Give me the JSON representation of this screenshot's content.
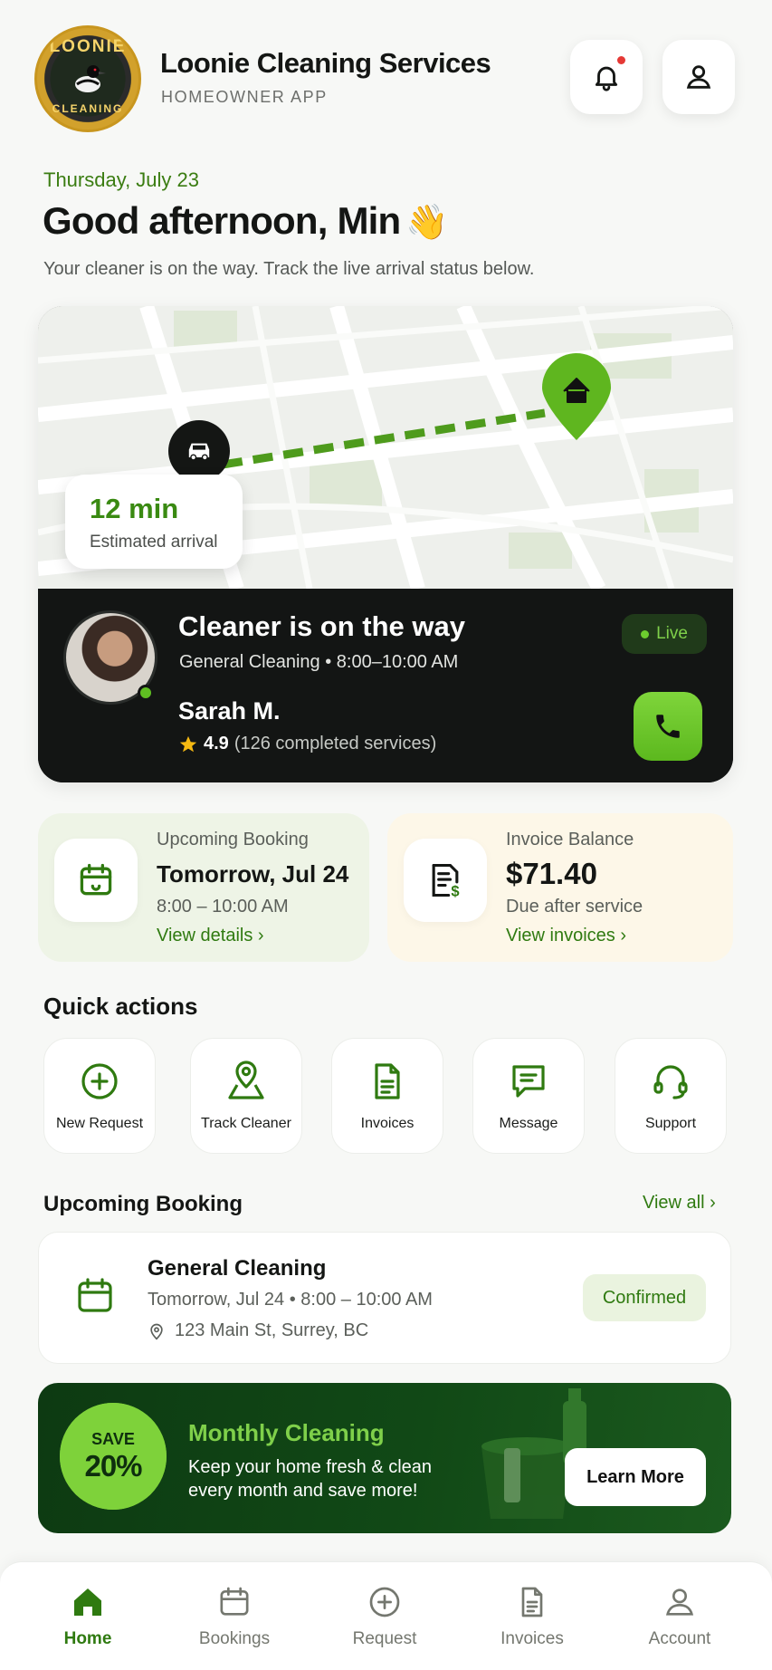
{
  "header": {
    "logo_top": "LOONIE",
    "logo_bottom": "CLEANING",
    "title": "Loonie Cleaning Services",
    "subtitle": "HOMEOWNER APP"
  },
  "greeting": {
    "date": "Thursday, July 23",
    "headline": "Good afternoon, Min",
    "emoji": "👋",
    "message": "Your cleaner is on the way. Track the live arrival status below."
  },
  "tracking": {
    "eta_value": "12 min",
    "eta_label": "Estimated arrival",
    "status_title": "Cleaner is on the way",
    "service": "General Cleaning  •  8:00–10:00 AM",
    "live_label": "Live",
    "cleaner_name": "Sarah M.",
    "rating": "4.9",
    "services_count": "(126 completed services)"
  },
  "cards": {
    "booking": {
      "label": "Upcoming Booking",
      "date": "Tomorrow, Jul 24",
      "time": "8:00 – 10:00 AM",
      "link": "View details ›"
    },
    "invoice": {
      "label": "Invoice Balance",
      "amount": "$71.40",
      "note": "Due after service",
      "link": "View invoices ›"
    }
  },
  "quick_actions": {
    "title": "Quick actions",
    "items": [
      {
        "label": "New Request",
        "icon": "plus-circle-icon"
      },
      {
        "label": "Track Cleaner",
        "icon": "map-pin-icon"
      },
      {
        "label": "Invoices",
        "icon": "document-icon"
      },
      {
        "label": "Message",
        "icon": "chat-icon"
      },
      {
        "label": "Support",
        "icon": "headset-icon"
      }
    ]
  },
  "upcoming": {
    "title": "Upcoming Booking",
    "view_all": "View all ›",
    "service": "General Cleaning",
    "time": "Tomorrow, Jul 24  •  8:00 – 10:00 AM",
    "address": "123 Main St, Surrey, BC",
    "status": "Confirmed"
  },
  "promo": {
    "badge_top": "SAVE",
    "badge_pct": "20%",
    "title": "Monthly Cleaning",
    "text": "Keep your home fresh & clean every month and save more!",
    "button": "Learn More"
  },
  "nav": {
    "items": [
      {
        "label": "Home",
        "icon": "home-icon",
        "active": true
      },
      {
        "label": "Bookings",
        "icon": "calendar-icon",
        "active": false
      },
      {
        "label": "Request",
        "icon": "plus-circle-icon",
        "active": false
      },
      {
        "label": "Invoices",
        "icon": "document-icon",
        "active": false
      },
      {
        "label": "Account",
        "icon": "user-icon",
        "active": false
      }
    ]
  },
  "colors": {
    "accent": "#3a8a12",
    "accent_light": "#7ed23a",
    "dark_panel": "#131514",
    "promo_bg": "#114916"
  }
}
